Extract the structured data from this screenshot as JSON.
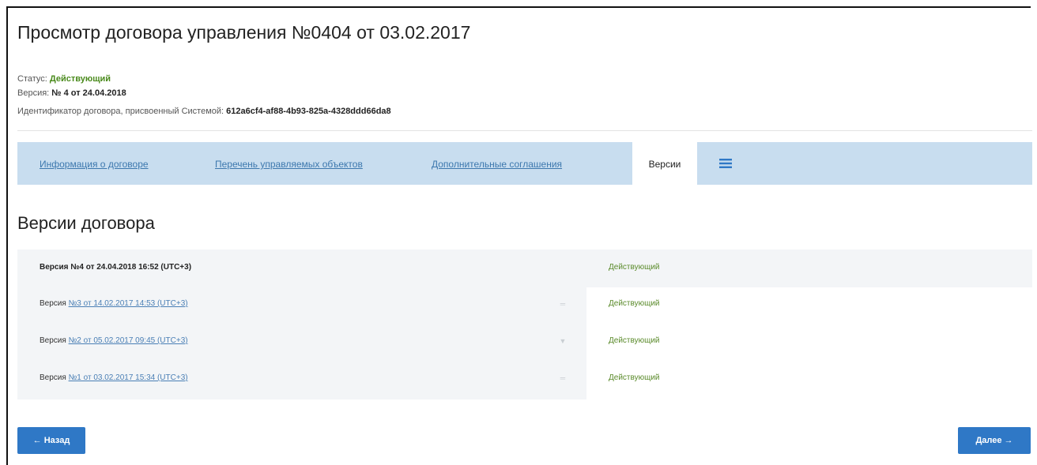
{
  "page": {
    "title": "Просмотр договора управления №0404 от 03.02.2017"
  },
  "meta": {
    "status_label": "Статус:",
    "status_value": "Действующий",
    "version_label": "Версия:",
    "version_value": "№ 4 от 24.04.2018",
    "id_label": "Идентификатор договора, присвоенный Системой:",
    "id_value": "612a6cf4-af88-4b93-825a-4328ddd66da8"
  },
  "tabs": [
    {
      "label": "Информация о договоре",
      "active": false
    },
    {
      "label": "Перечень управляемых объектов",
      "active": false
    },
    {
      "label": "Дополнительные соглашения",
      "active": false
    },
    {
      "label": "Версии",
      "active": true
    }
  ],
  "menu_icon": "list-icon",
  "section": {
    "title": "Версии договора"
  },
  "versions": [
    {
      "prefix": "Версия",
      "link": "№4 от 24.04.2018 16:52 (UTC+3)",
      "status": "Действующий",
      "current": true,
      "icon": ""
    },
    {
      "prefix": "Версия",
      "link": "№3 от 14.02.2017 14:53 (UTC+3)",
      "status": "Действующий",
      "current": false,
      "icon": "equals-icon"
    },
    {
      "prefix": "Версия",
      "link": "№2 от 05.02.2017 09:45 (UTC+3)",
      "status": "Действующий",
      "current": false,
      "icon": "funnel-icon"
    },
    {
      "prefix": "Версия",
      "link": "№1 от 03.02.2017 15:34 (UTC+3)",
      "status": "Действующий",
      "current": false,
      "icon": "equals-icon"
    }
  ],
  "buttons": {
    "back": "← Назад",
    "next": "Далее →"
  },
  "colors": {
    "tab_bar": "#c8ddef",
    "link": "#3d78ae",
    "status_green": "#4a8a1c",
    "button": "#2f78c6"
  }
}
